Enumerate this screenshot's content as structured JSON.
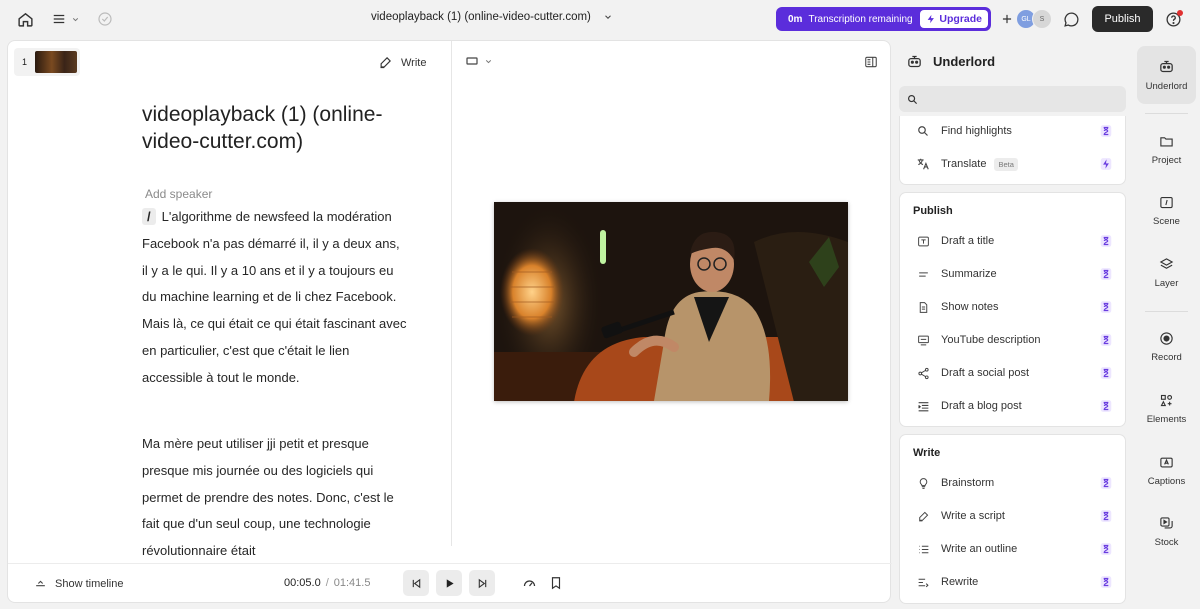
{
  "topbar": {
    "project_title": "videoplayback (1) (online-video-cutter.com)",
    "transcription": {
      "amount": "0m",
      "label": "Transcription remaining",
      "upgrade_label": "Upgrade"
    },
    "collaborators": [
      "GL",
      "S"
    ],
    "publish_label": "Publish"
  },
  "editor": {
    "scene_number": "1",
    "write_label": "Write",
    "doc_title": "videoplayback (1) (online-video-cutter.com)",
    "add_speaker": "Add speaker",
    "slash": "/",
    "paragraph1": "L'algorithme de newsfeed la modération Facebook n'a pas démarré il, il y a deux ans, il y a le qui. Il y a 10 ans et il y a toujours eu du machine learning et de li chez Facebook. Mais là, ce qui était ce qui était fascinant avec en particulier, c'est que c'était le lien accessible à tout le monde.",
    "paragraph2": "Ma mère peut utiliser jji petit et presque presque mis journée ou des logiciels qui permet de prendre des notes. Donc, c'est le fait que d'un seul coup, une technologie révolutionnaire était"
  },
  "playback": {
    "show_timeline": "Show timeline",
    "current_time": "00:05.0",
    "separator": "/",
    "total_time": "01:41.5"
  },
  "underlord": {
    "title": "Underlord",
    "search_placeholder": "",
    "top_items": [
      {
        "label": "Find highlights",
        "icon": "search-icon"
      },
      {
        "label": "Translate",
        "icon": "translate-icon",
        "badge": "Beta"
      }
    ],
    "publish": {
      "title": "Publish",
      "items": [
        "Draft a title",
        "Summarize",
        "Show notes",
        "YouTube description",
        "Draft a social post",
        "Draft a blog post"
      ]
    },
    "write": {
      "title": "Write",
      "items": [
        "Brainstorm",
        "Write a script",
        "Write an outline",
        "Rewrite"
      ]
    }
  },
  "rail": [
    "Underlord",
    "Project",
    "Scene",
    "Layer",
    "Record",
    "Elements",
    "Captions",
    "Stock"
  ],
  "colors": {
    "accent": "#5b2ddb",
    "publish_bg": "#2a2a2a"
  }
}
